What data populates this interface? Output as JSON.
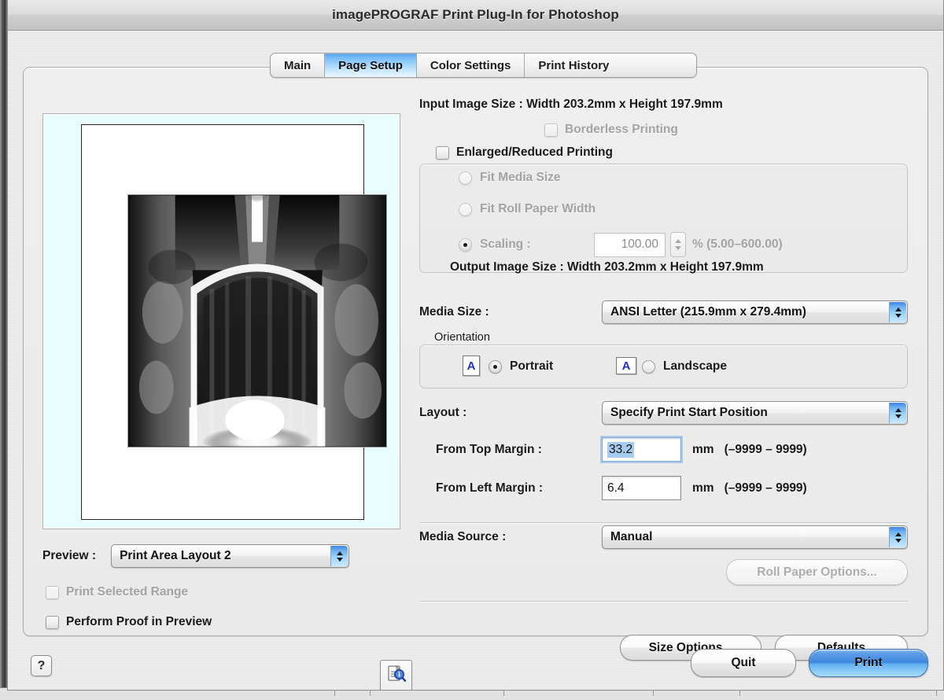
{
  "window": {
    "title": "imagePROGRAF Print Plug-In for Photoshop"
  },
  "tabs": [
    {
      "label": "Main",
      "active": false
    },
    {
      "label": "Page Setup",
      "active": true
    },
    {
      "label": "Color Settings",
      "active": false
    },
    {
      "label": "Print History",
      "active": false
    }
  ],
  "preview": {
    "label": "Preview :",
    "value": "Print Area Layout 2",
    "print_selected_range": "Print Selected Range",
    "perform_proof": "Perform Proof in Preview",
    "info_icon": "document-info-icon"
  },
  "size": {
    "input_image_size": "Input Image Size : Width 203.2mm x Height 197.9mm",
    "borderless_printing": "Borderless Printing",
    "enlarged_reduced": "Enlarged/Reduced Printing",
    "fit_media_size": "Fit Media Size",
    "fit_roll_paper_width": "Fit Roll Paper Width",
    "scaling_label": "Scaling :",
    "scaling_value": "100.00",
    "scaling_range": "% (5.00–600.00)",
    "output_image_size": "Output Image Size : Width 203.2mm x Height 197.9mm"
  },
  "media_size": {
    "label": "Media Size :",
    "value": "ANSI Letter (215.9mm x 279.4mm)"
  },
  "orientation": {
    "legend": "Orientation",
    "portrait": "Portrait",
    "landscape": "Landscape",
    "icon_glyph": "A",
    "selected": "Portrait"
  },
  "layout": {
    "label": "Layout :",
    "value": "Specify Print Start Position",
    "from_top_margin_label": "From Top Margin :",
    "from_top_margin_value": "33.2",
    "from_top_margin_unit": "mm",
    "from_top_margin_range": "(–9999 – 9999)",
    "from_left_margin_label": "From Left Margin :",
    "from_left_margin_value": "6.4",
    "from_left_margin_unit": "mm",
    "from_left_margin_range": "(–9999 – 9999)"
  },
  "media_source": {
    "label": "Media Source :",
    "value": "Manual",
    "roll_paper_options": "Roll Paper Options..."
  },
  "actions": {
    "size_options": "Size Options...",
    "defaults": "Defaults",
    "quit": "Quit",
    "print": "Print",
    "help": "?"
  },
  "colors": {
    "accent_blue": "#3f86dd",
    "tab_active": "#9fd3fb",
    "selection": "#a6cbee",
    "preview_bg": "#e9ffff"
  }
}
